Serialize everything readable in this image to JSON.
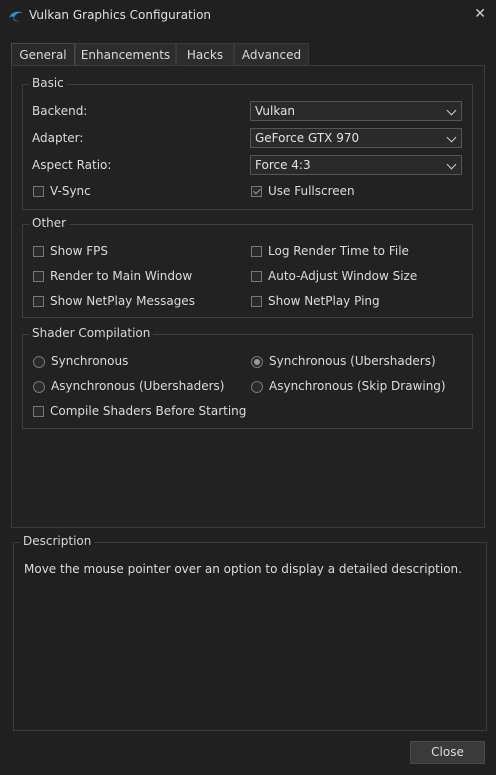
{
  "window": {
    "title": "Vulkan Graphics Configuration",
    "close_glyph": "✕"
  },
  "tabs": [
    "General",
    "Enhancements",
    "Hacks",
    "Advanced"
  ],
  "active_tab": "General",
  "basic": {
    "legend": "Basic",
    "backend": {
      "label": "Backend:",
      "value": "Vulkan"
    },
    "adapter": {
      "label": "Adapter:",
      "value": "GeForce GTX 970"
    },
    "aspect_ratio": {
      "label": "Aspect Ratio:",
      "value": "Force 4:3"
    },
    "vsync": {
      "label": "V-Sync",
      "checked": false
    },
    "fullscreen": {
      "label": "Use Fullscreen",
      "checked": true
    }
  },
  "other": {
    "legend": "Other",
    "show_fps": {
      "label": "Show FPS",
      "checked": false
    },
    "log_render_time": {
      "label": "Log Render Time to File",
      "checked": false
    },
    "render_main": {
      "label": "Render to Main Window",
      "checked": false
    },
    "auto_adjust": {
      "label": "Auto-Adjust Window Size",
      "checked": false
    },
    "netplay_msgs": {
      "label": "Show NetPlay Messages",
      "checked": false
    },
    "netplay_ping": {
      "label": "Show NetPlay Ping",
      "checked": false
    }
  },
  "shader": {
    "legend": "Shader Compilation",
    "sync": {
      "label": "Synchronous",
      "selected": false
    },
    "sync_uber": {
      "label": "Synchronous (Ubershaders)",
      "selected": true
    },
    "async_uber": {
      "label": "Asynchronous (Ubershaders)",
      "selected": false
    },
    "async_skip": {
      "label": "Asynchronous (Skip Drawing)",
      "selected": false
    },
    "compile_before": {
      "label": "Compile Shaders Before Starting",
      "checked": false
    }
  },
  "description": {
    "legend": "Description",
    "text": "Move the mouse pointer over an option to display a detailed description."
  },
  "footer": {
    "close_label": "Close"
  }
}
